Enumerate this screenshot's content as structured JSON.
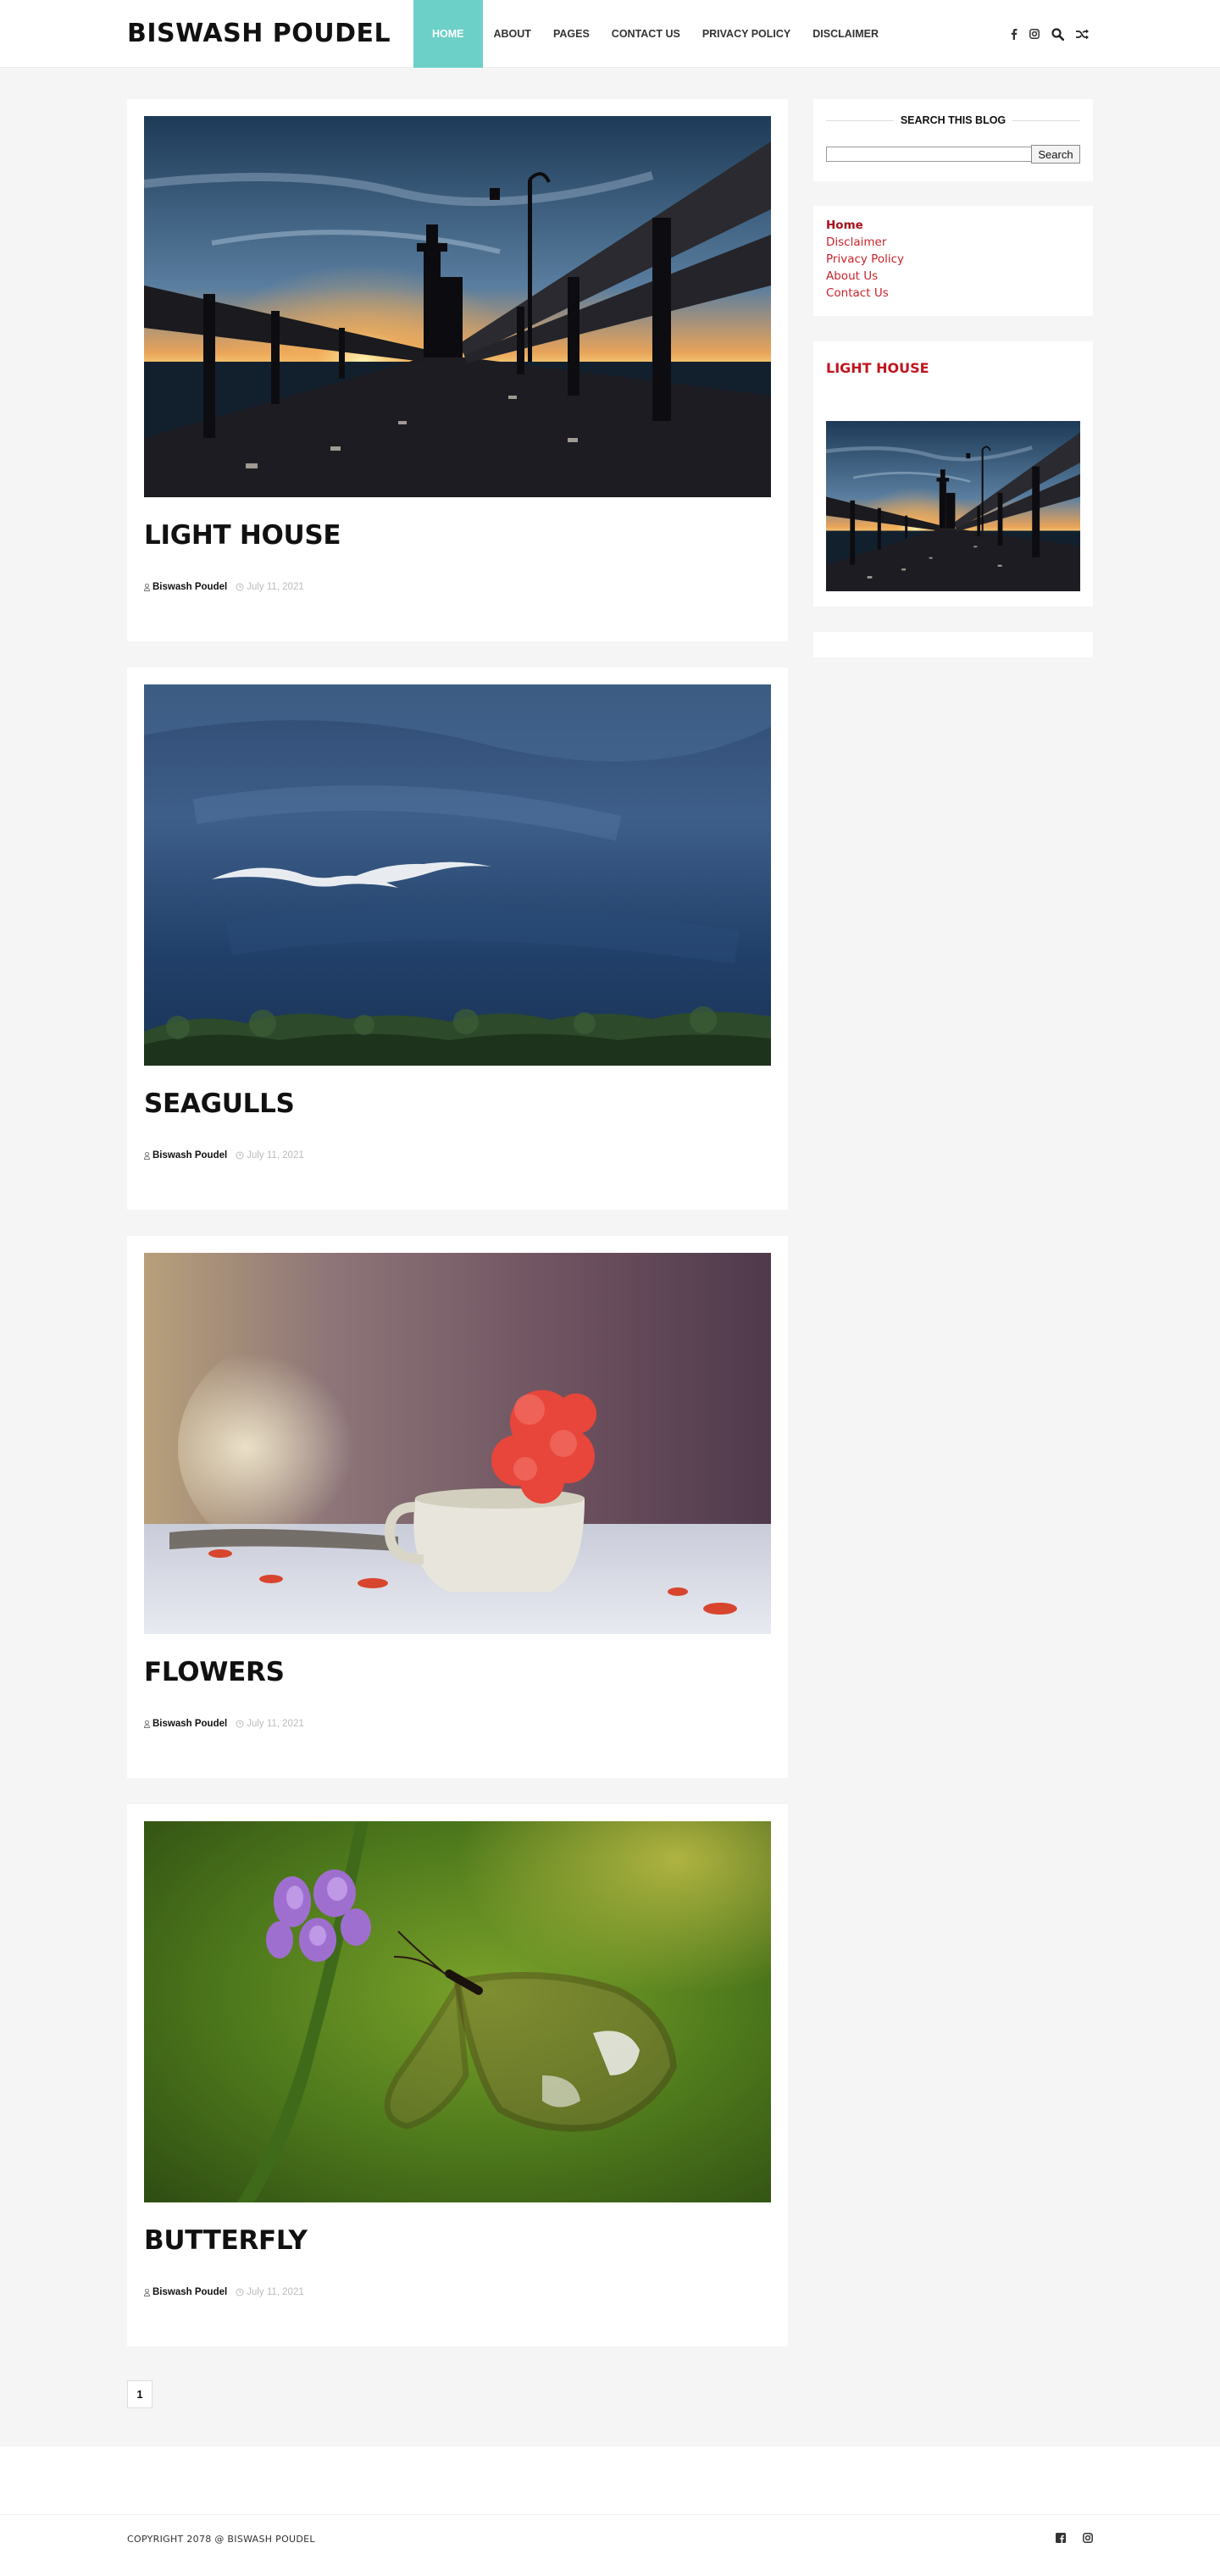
{
  "site": {
    "title": "BISWASH POUDEL"
  },
  "nav": {
    "items": [
      {
        "label": "HOME"
      },
      {
        "label": "ABOUT"
      },
      {
        "label": "PAGES"
      },
      {
        "label": "CONTACT US"
      },
      {
        "label": "PRIVACY POLICY"
      },
      {
        "label": "DISCLAIMER"
      }
    ],
    "icons": [
      "facebook-icon",
      "instagram-icon",
      "search-icon",
      "shuffle-icon"
    ]
  },
  "posts": [
    {
      "title": "LIGHT HOUSE",
      "author": "Biswash Poudel",
      "date": "July 11, 2021",
      "image": "lighthouse-pier"
    },
    {
      "title": "SEAGULLS",
      "author": "Biswash Poudel",
      "date": "July 11, 2021",
      "image": "seagulls-sky"
    },
    {
      "title": "FLOWERS",
      "author": "Biswash Poudel",
      "date": "July 11, 2021",
      "image": "flower-cup"
    },
    {
      "title": "BUTTERFLY",
      "author": "Biswash Poudel",
      "date": "July 11, 2021",
      "image": "glasswing-butterfly"
    }
  ],
  "sidebar": {
    "search": {
      "title": "SEARCH THIS BLOG",
      "button": "Search",
      "value": ""
    },
    "pages": [
      {
        "label": "Home"
      },
      {
        "label": "Disclaimer"
      },
      {
        "label": "Privacy Policy"
      },
      {
        "label": "About Us"
      },
      {
        "label": "Contact Us"
      }
    ],
    "featured": {
      "title": "LIGHT HOUSE"
    }
  },
  "pagination": {
    "current": "1"
  },
  "footer": {
    "copyright": "COPYRIGHT 2078 @ BISWASH POUDEL",
    "icons": [
      "facebook-icon",
      "instagram-icon"
    ]
  },
  "colors": {
    "accent": "#6dd0c8",
    "link": "#c8232c",
    "background": "#f5f5f5"
  }
}
